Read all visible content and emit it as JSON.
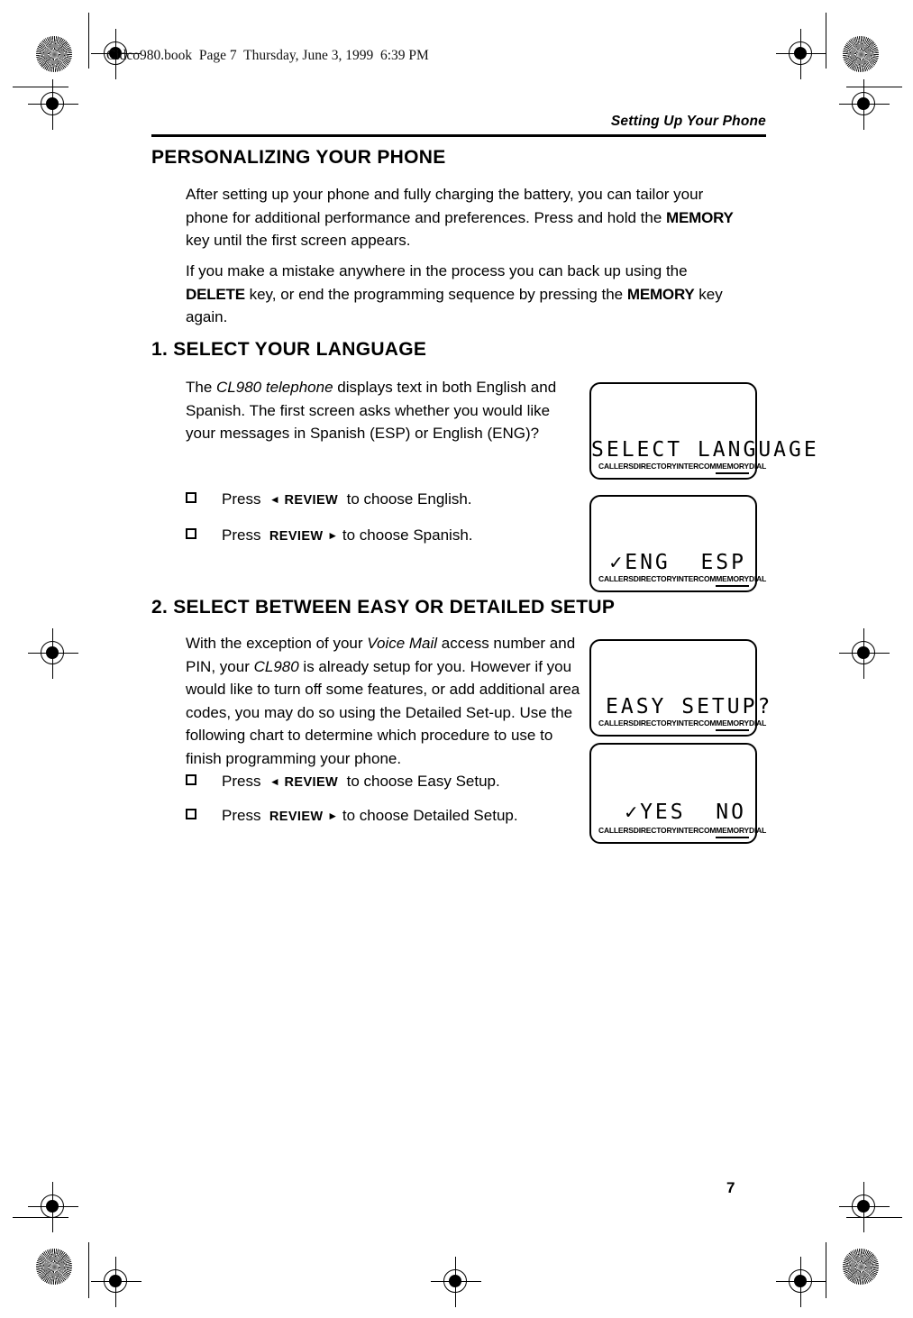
{
  "file_stamp": "Cidco980.book  Page 7  Thursday, June 3, 1999  6:39 PM",
  "running_head": "Setting Up Your Phone",
  "page_number": "7",
  "headings": {
    "personalizing": {
      "first": "P",
      "rest": "ERSONALIZING ",
      "first2": "Y",
      "rest2": "OUR ",
      "first3": "P",
      "rest3": "HONE"
    },
    "personalizing_full": "PERSONALIZING YOUR PHONE",
    "section1_number": "1. ",
    "section1_full": "SELECT YOUR LANGUAGE",
    "section2_number": "2. ",
    "section2_full": "SELECT BETWEEN EASY OR DETAILED SETUP"
  },
  "paragraphs": {
    "intro1_a": "After setting up your phone and fully charging the battery, you can tailor your phone for additional performance and preferences. Press and hold the ",
    "intro1_key": "MEMORY",
    "intro1_b": " key until the first screen appears.",
    "intro2_a": "If you make a mistake anywhere in the process you can back up using the ",
    "intro2_key1": "DELETE",
    "intro2_b": " key, or end the programming sequence by pressing the ",
    "intro2_key2": "MEMORY",
    "intro2_c": " key again.",
    "lang_a": "The ",
    "lang_italic": "CL980 telephone",
    "lang_b": " displays text in both English and Spanish. The first screen asks whether you would like your messages in Spanish (ESP) or English (ENG)?",
    "setup_a": "With the exception of your ",
    "setup_italic1": "Voice Mail",
    "setup_b": " access number and PIN, your ",
    "setup_italic2": "CL980",
    "setup_c": " is already setup for you. However if you would like to turn off some features, or add additional area codes, you may do so using the Detailed Set-up. Use the following chart to determine which procedure to use to finish programming your phone."
  },
  "bullets": [
    {
      "press": "Press",
      "arrow": "◄",
      "arrow_position": "before",
      "key": "REVIEW",
      "tail": "to choose English."
    },
    {
      "press": "Press",
      "arrow": "►",
      "arrow_position": "after",
      "key": "REVIEW",
      "tail": "to choose Spanish."
    },
    {
      "press": "Press",
      "arrow": "◄",
      "arrow_position": "before",
      "key": "REVIEW",
      "tail": "to choose Easy Setup."
    },
    {
      "press": "Press",
      "arrow": "►",
      "arrow_position": "after",
      "key": "REVIEW",
      "tail": "to choose Detailed Setup."
    }
  ],
  "lcd_softkeys": {
    "callers": "CALLERS",
    "directory": "DIRECTORY",
    "intercom": "INTERCOM",
    "memory": "MEMORY",
    "dial": "DIAL"
  },
  "lcd_screens": [
    {
      "text": "SELECT LANGUAGE",
      "align": "right"
    },
    {
      "text": "✓ENG  ESP",
      "align": "right"
    },
    {
      "text": "EASY SETUP?",
      "align": "left"
    },
    {
      "text": "✓YES  NO",
      "align": "right"
    }
  ]
}
